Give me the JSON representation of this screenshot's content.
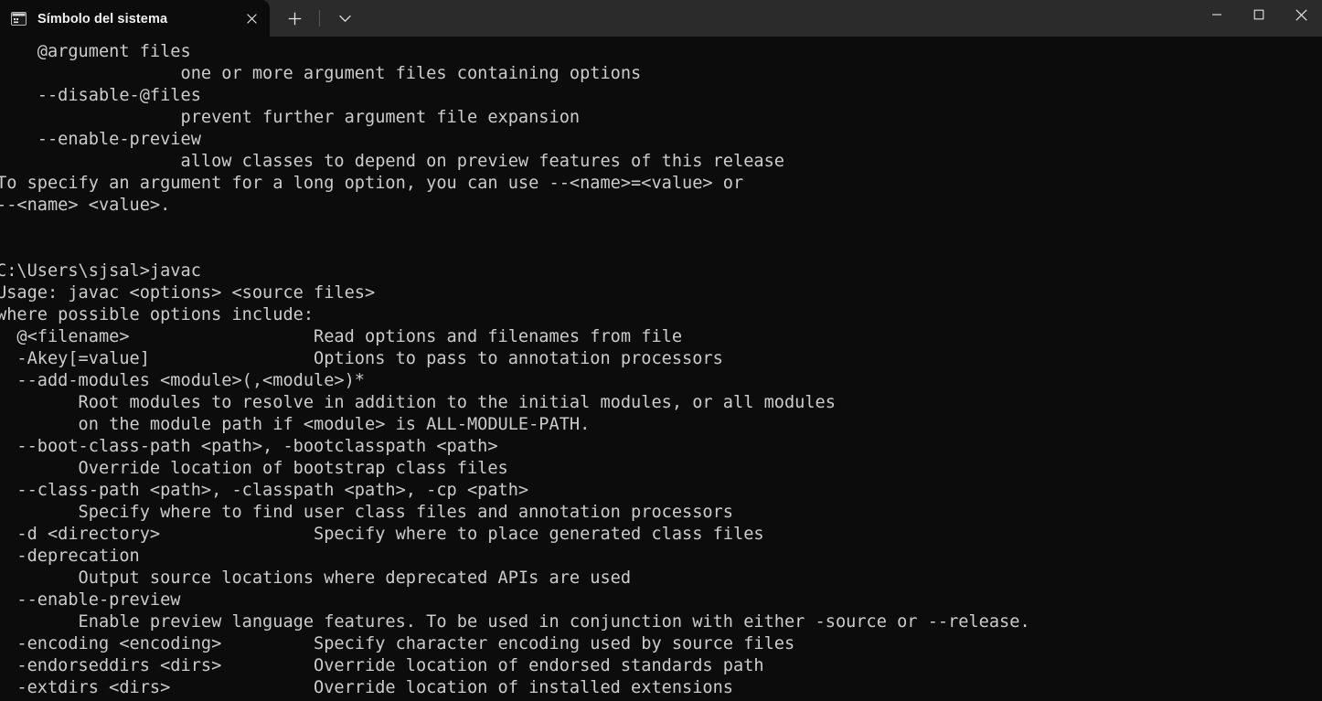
{
  "window": {
    "app": "Windows Terminal",
    "title": "Símbolo del sistema",
    "colors": {
      "titlebar_bg": "#2b2b2b",
      "tab_active_bg": "#0c0c0c",
      "terminal_bg": "#0c0c0c",
      "terminal_fg": "#cccccc",
      "close_hover": "#c42b1c"
    }
  },
  "tabs": [
    {
      "label": "Símbolo del sistema",
      "icon": "console-icon",
      "active": true,
      "close_label": "×"
    }
  ],
  "tabstrip": {
    "new_tab_label": "+",
    "new_tab_icon": "plus-icon",
    "dropdown_label": "⌄",
    "dropdown_icon": "chevron-down-icon"
  },
  "caption": {
    "minimize_label": "—",
    "minimize_icon": "minimize-icon",
    "maximize_label": "□",
    "maximize_icon": "maximize-icon",
    "close_label": "✕",
    "close_icon": "close-icon"
  },
  "terminal": {
    "prompt": "C:\\Users\\sjsal>",
    "command": "javac",
    "lines": [
      "    @argument files",
      "                  one or more argument files containing options",
      "    --disable-@files",
      "                  prevent further argument file expansion",
      "    --enable-preview",
      "                  allow classes to depend on preview features of this release",
      "To specify an argument for a long option, you can use --<name>=<value> or",
      "--<name> <value>.",
      "",
      "",
      "C:\\Users\\sjsal>javac",
      "Usage: javac <options> <source files>",
      "where possible options include:",
      "  @<filename>                  Read options and filenames from file",
      "  -Akey[=value]                Options to pass to annotation processors",
      "  --add-modules <module>(,<module>)*",
      "        Root modules to resolve in addition to the initial modules, or all modules",
      "        on the module path if <module> is ALL-MODULE-PATH.",
      "  --boot-class-path <path>, -bootclasspath <path>",
      "        Override location of bootstrap class files",
      "  --class-path <path>, -classpath <path>, -cp <path>",
      "        Specify where to find user class files and annotation processors",
      "  -d <directory>               Specify where to place generated class files",
      "  -deprecation",
      "        Output source locations where deprecated APIs are used",
      "  --enable-preview",
      "        Enable preview language features. To be used in conjunction with either -source or --release.",
      "  -encoding <encoding>         Specify character encoding used by source files",
      "  -endorseddirs <dirs>         Override location of endorsed standards path",
      "  -extdirs <dirs>              Override location of installed extensions"
    ]
  }
}
